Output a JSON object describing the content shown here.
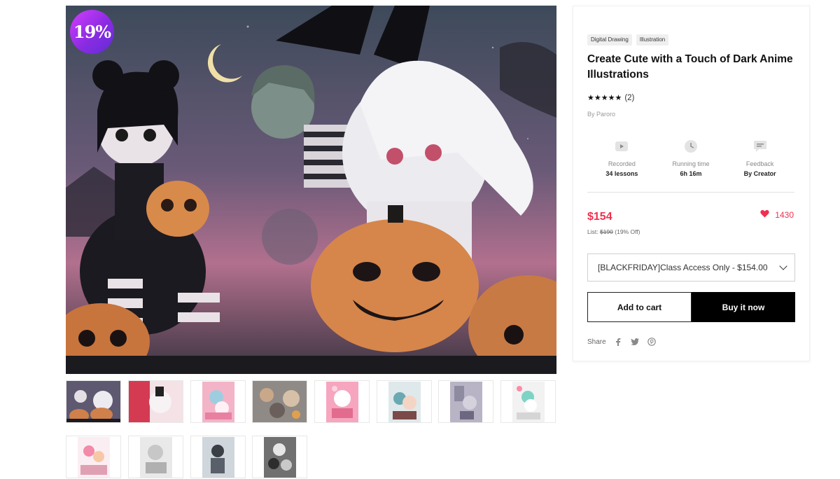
{
  "hero": {
    "discount_badge": "19%"
  },
  "thumbnails": {
    "count": 12,
    "active_index": 0
  },
  "product": {
    "tags": [
      "Digital Drawing",
      "Illustration"
    ],
    "title": "Create Cute with a Touch of Dark Anime Illustrations",
    "rating_stars": "★★★★★",
    "rating_count": "(2)",
    "author": "By Paroro",
    "stats": [
      {
        "icon": "play-icon",
        "label": "Recorded",
        "value": "34 lessons"
      },
      {
        "icon": "clock-icon",
        "label": "Running time",
        "value": "6h 16m"
      },
      {
        "icon": "chat-icon",
        "label": "Feedback",
        "value": "By Creator"
      }
    ],
    "price": "$154",
    "likes": "1430",
    "list_prefix": "List:",
    "list_price": "$190",
    "list_discount": "(19% Off)",
    "option_selected": "[BLACKFRIDAY]Class Access Only - $154.00",
    "add_to_cart": "Add to cart",
    "buy_now": "Buy it now",
    "share_label": "Share",
    "share_icons": [
      "facebook-icon",
      "twitter-icon",
      "pinterest-icon"
    ]
  },
  "colors": {
    "accent": "#f0304e",
    "badge_gradient_start": "#d43dff",
    "badge_gradient_end": "#5f2dd6"
  }
}
